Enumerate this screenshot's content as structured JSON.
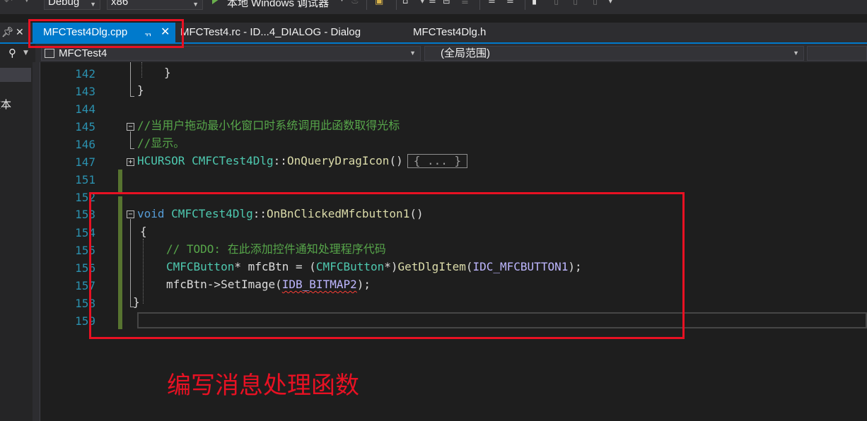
{
  "toolbar": {
    "config": "Debug",
    "platform": "x86",
    "run_label": "本地 Windows 调试器"
  },
  "tabs": [
    {
      "label": "MFCTest4Dlg.cpp",
      "active": true
    },
    {
      "label": "MFCTest4.rc - ID...4_DIALOG - Dialog",
      "active": false
    },
    {
      "label": "MFCTest4Dlg.h",
      "active": false
    }
  ],
  "navbar": {
    "project": "MFCTest4",
    "scope": "(全局范围)"
  },
  "side_panel": {
    "partial_text": "文本"
  },
  "editor": {
    "line_numbers": [
      "142",
      "143",
      "144",
      "145",
      "146",
      "147",
      "151",
      "152",
      "153",
      "154",
      "155",
      "156",
      "157",
      "158",
      "159"
    ],
    "lines": {
      "l142": "}",
      "l143": "}",
      "l145": "//当用户拖动最小化窗口时系统调用此函数取得光标",
      "l146": "//显示。",
      "l147_type": "HCURSOR",
      "l147_class": "CMFCTest4Dlg",
      "l147_sep": "::",
      "l147_func": "OnQueryDragIcon",
      "l147_parens": "()",
      "l147_collapsed": "{ ... }",
      "l153_kw": "void",
      "l153_class": "CMFCTest4Dlg",
      "l153_sep": "::",
      "l153_func": "OnBnClickedMfcbutton1",
      "l153_parens": "()",
      "l154": "{",
      "l155": "// TODO: 在此添加控件通知处理程序代码",
      "l156_type": "CMFCButton",
      "l156_ptr": "* ",
      "l156_var": "mfcBtn",
      "l156_eq": " = (",
      "l156_cast": "CMFCButton",
      "l156_castend": "*)",
      "l156_func": "GetDlgItem",
      "l156_open": "(",
      "l156_macro": "IDC_MFCBUTTON1",
      "l156_close": ");",
      "l157_var": "mfcBtn",
      "l157_arrow": "->SetImage(",
      "l157_macro": "IDB_BITMAP2",
      "l157_close": ");",
      "l158": "}"
    }
  },
  "annotation": {
    "caption": "编写消息处理函数",
    "color": "#e81123"
  },
  "colors": {
    "accent": "#007acc",
    "keyword": "#569cd6",
    "type": "#4ec9b0",
    "function": "#dcdcaa",
    "comment": "#57a64a",
    "macro": "#beb7ff",
    "line_number": "#2b91af"
  }
}
